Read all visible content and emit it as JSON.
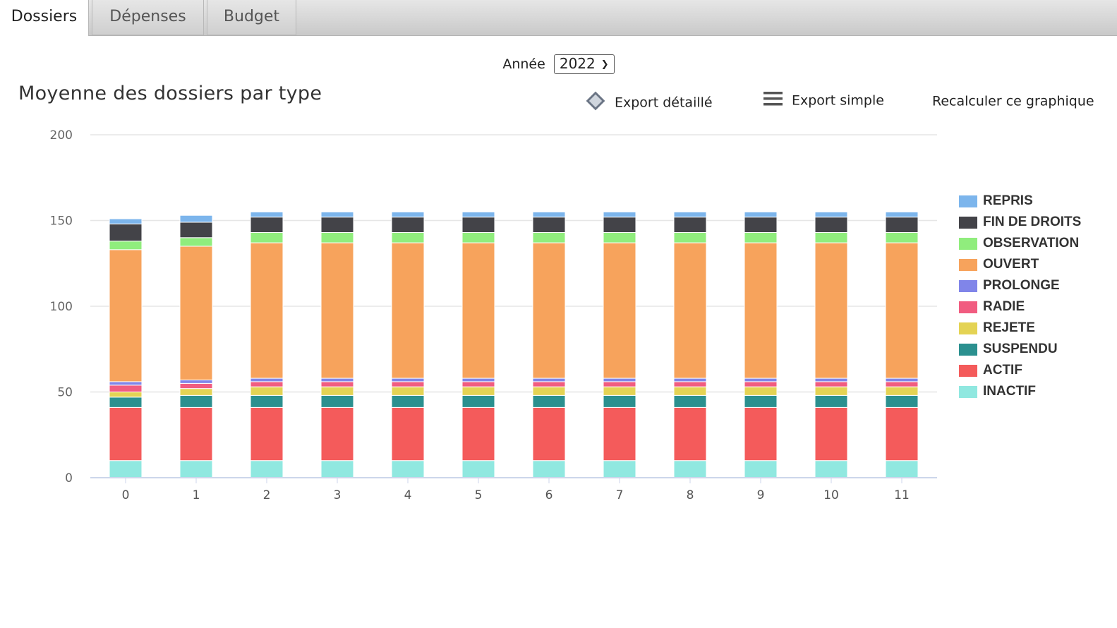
{
  "tabs": [
    {
      "label": "Dossiers",
      "active": true
    },
    {
      "label": "Dépenses",
      "active": false
    },
    {
      "label": "Budget",
      "active": false
    }
  ],
  "year_filter": {
    "label": "Année",
    "value": "2022"
  },
  "actions": {
    "export_detailed": "Export détaillé",
    "export_simple": "Export simple",
    "recalculate": "Recalculer ce graphique"
  },
  "chart_data": {
    "type": "bar",
    "stacked": true,
    "title": "Moyenne des dossiers par type",
    "xlabel": "",
    "ylabel": "",
    "ylim": [
      0,
      200
    ],
    "yticks": [
      0,
      50,
      100,
      150,
      200
    ],
    "grid": true,
    "legend_position": "right",
    "categories": [
      "0",
      "1",
      "2",
      "3",
      "4",
      "5",
      "6",
      "7",
      "8",
      "9",
      "10",
      "11"
    ],
    "series": [
      {
        "name": "INACTIF",
        "color": "#90e8e0",
        "values": [
          10,
          10,
          10,
          10,
          10,
          10,
          10,
          10,
          10,
          10,
          10,
          10
        ]
      },
      {
        "name": "ACTIF",
        "color": "#f45b5b",
        "values": [
          31,
          31,
          31,
          31,
          31,
          31,
          31,
          31,
          31,
          31,
          31,
          31
        ]
      },
      {
        "name": "SUSPENDU",
        "color": "#2b908f",
        "values": [
          6,
          7,
          7,
          7,
          7,
          7,
          7,
          7,
          7,
          7,
          7,
          7
        ]
      },
      {
        "name": "REJETE",
        "color": "#e4d354",
        "values": [
          3,
          4,
          5,
          5,
          5,
          5,
          5,
          5,
          5,
          5,
          5,
          5
        ]
      },
      {
        "name": "RADIE",
        "color": "#f15c80",
        "values": [
          4,
          3,
          3,
          3,
          3,
          3,
          3,
          3,
          3,
          3,
          3,
          3
        ]
      },
      {
        "name": "PROLONGE",
        "color": "#8085e9",
        "values": [
          2,
          2,
          2,
          2,
          2,
          2,
          2,
          2,
          2,
          2,
          2,
          2
        ]
      },
      {
        "name": "OUVERT",
        "color": "#f7a35c",
        "values": [
          77,
          78,
          79,
          79,
          79,
          79,
          79,
          79,
          79,
          79,
          79,
          79
        ]
      },
      {
        "name": "OBSERVATION",
        "color": "#90ed7d",
        "values": [
          5,
          5,
          6,
          6,
          6,
          6,
          6,
          6,
          6,
          6,
          6,
          6
        ]
      },
      {
        "name": "FIN DE DROITS",
        "color": "#434348",
        "values": [
          10,
          9,
          9,
          9,
          9,
          9,
          9,
          9,
          9,
          9,
          9,
          9
        ]
      },
      {
        "name": "REPRIS",
        "color": "#7cb5ec",
        "values": [
          3,
          4,
          3,
          3,
          3,
          3,
          3,
          3,
          3,
          3,
          3,
          3
        ]
      }
    ]
  }
}
